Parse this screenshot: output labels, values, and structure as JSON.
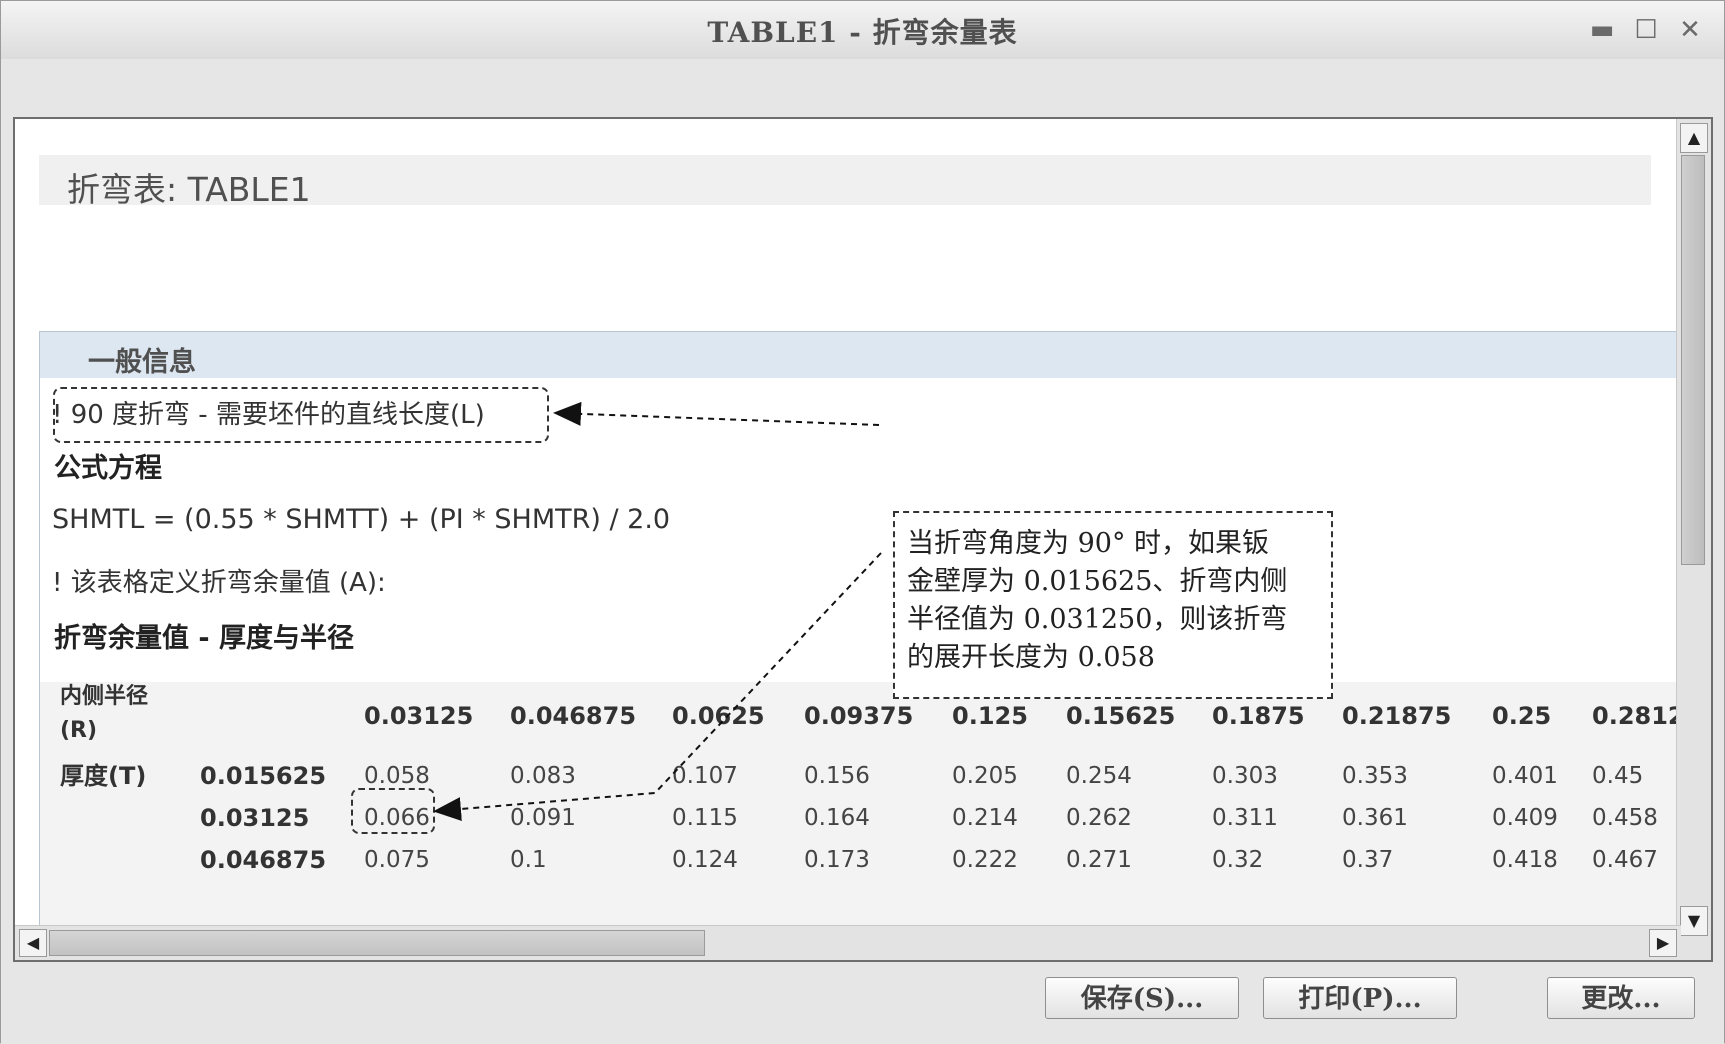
{
  "window": {
    "title": "TABLE1 - 折弯余量表",
    "minimize": "▬",
    "maximize": "☐",
    "close": "✕"
  },
  "page": {
    "title": "折弯表: TABLE1"
  },
  "section": {
    "title": "一般信息",
    "note_90": "! 90 度折弯 - 需要坯件的直线长度(L)",
    "formula_heading": "公式方程",
    "formula": "SHMTL = (0.55 * SHMTT) + (PI * SHMTR) / 2.0",
    "note_table": "! 该表格定义折弯余量值 (A):",
    "table_heading": "折弯余量值 - 厚度与半径"
  },
  "table": {
    "radius_label": "内侧半径 (R)",
    "thickness_label": "厚度(T)",
    "radius_values": [
      "0.03125",
      "0.046875",
      "0.0625",
      "0.09375",
      "0.125",
      "0.15625",
      "0.1875",
      "0.21875",
      "0.25",
      "0.2812"
    ],
    "rows": [
      {
        "thickness": "0.015625",
        "values": [
          "0.058",
          "0.083",
          "0.107",
          "0.156",
          "0.205",
          "0.254",
          "0.303",
          "0.353",
          "0.401",
          "0.45"
        ]
      },
      {
        "thickness": "0.03125",
        "values": [
          "0.066",
          "0.091",
          "0.115",
          "0.164",
          "0.214",
          "0.262",
          "0.311",
          "0.361",
          "0.409",
          "0.458"
        ]
      },
      {
        "thickness": "0.046875",
        "values": [
          "0.075",
          "0.1",
          "0.124",
          "0.173",
          "0.222",
          "0.271",
          "0.32",
          "0.37",
          "0.418",
          "0.467"
        ]
      }
    ]
  },
  "callout": {
    "lines": [
      "当折弯角度为 90° 时，如果钣",
      "金壁厚为 0.015625、折弯内侧",
      "半径值为 0.031250，则该折弯",
      "的展开长度为 0.058"
    ]
  },
  "buttons": {
    "save": "保存(S)...",
    "print": "打印(P)...",
    "modify": "更改..."
  },
  "scrollbars": {
    "up": "▲",
    "down": "▼",
    "left": "◀",
    "right": "▶"
  }
}
